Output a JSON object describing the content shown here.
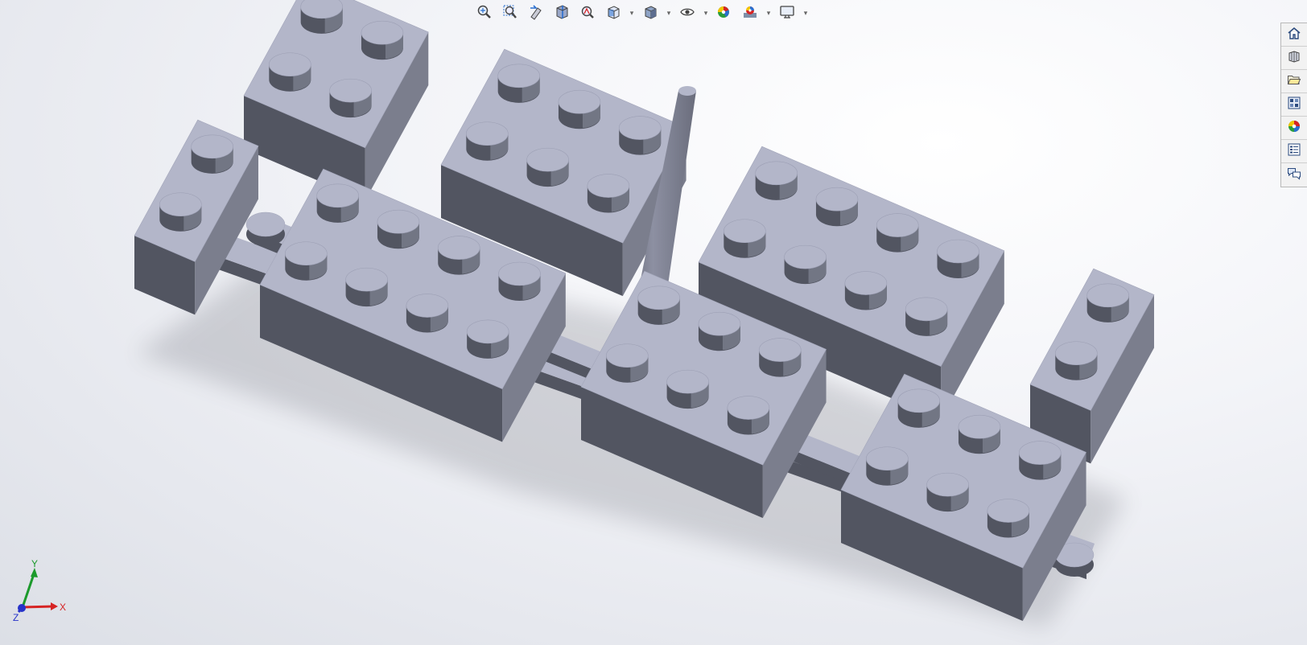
{
  "heads_up_toolbar": {
    "buttons": [
      {
        "id": "zoom-to-fit",
        "icon": "zoom-to-fit-icon"
      },
      {
        "id": "zoom-to-area",
        "icon": "zoom-to-area-icon"
      },
      {
        "id": "previous-view",
        "icon": "previous-view-icon"
      },
      {
        "id": "section-view",
        "icon": "section-view-icon"
      },
      {
        "id": "dynamic-annotation-views",
        "icon": "dynamic-annotation-icon"
      },
      {
        "id": "view-orientation",
        "icon": "view-orientation-icon",
        "dropdown": true
      },
      {
        "id": "display-style",
        "icon": "display-style-icon",
        "dropdown": true
      },
      {
        "id": "hide-show-items",
        "icon": "hide-show-icon",
        "dropdown": true
      },
      {
        "id": "edit-appearance",
        "icon": "edit-appearance-icon"
      },
      {
        "id": "apply-scene",
        "icon": "apply-scene-icon",
        "dropdown": true
      },
      {
        "id": "view-settings",
        "icon": "view-settings-icon",
        "dropdown": true
      }
    ]
  },
  "task_pane": {
    "tabs": [
      {
        "id": "solidworks-resources",
        "icon": "home-icon"
      },
      {
        "id": "design-library",
        "icon": "design-library-icon"
      },
      {
        "id": "file-explorer",
        "icon": "folder-icon"
      },
      {
        "id": "view-palette",
        "icon": "view-palette-icon"
      },
      {
        "id": "appearances-scenes",
        "icon": "appearances-icon"
      },
      {
        "id": "custom-properties",
        "icon": "custom-properties-icon"
      },
      {
        "id": "forum",
        "icon": "forum-icon"
      }
    ]
  },
  "triad": {
    "x_label": "X",
    "y_label": "Y",
    "z_label": "Z"
  },
  "colors": {
    "part_top": "#b3b6c9",
    "part_front": "#525561",
    "part_side": "#7b7e8d",
    "axis_x": "#d62424",
    "axis_y": "#1c9a2c",
    "axis_z": "#2733c9"
  }
}
